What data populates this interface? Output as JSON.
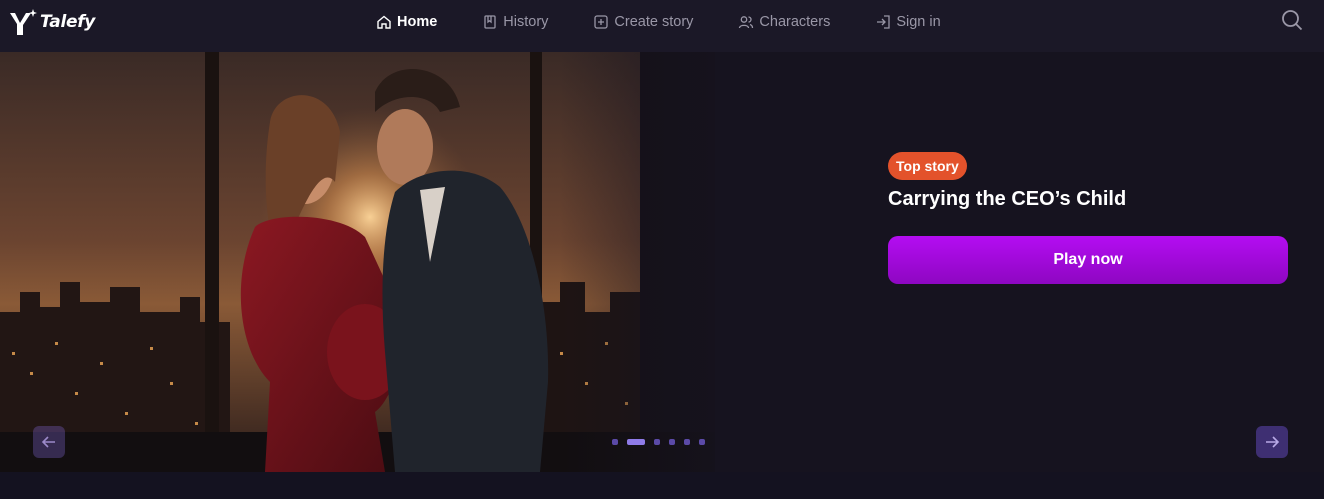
{
  "brand": {
    "name": "Talefy"
  },
  "nav": {
    "items": [
      {
        "label": "Home",
        "icon": "home-icon",
        "active": true
      },
      {
        "label": "History",
        "icon": "bookmark-icon",
        "active": false
      },
      {
        "label": "Create story",
        "icon": "plus-square-icon",
        "active": false
      },
      {
        "label": "Characters",
        "icon": "users-icon",
        "active": false
      },
      {
        "label": "Sign in",
        "icon": "sign-in-icon",
        "active": false
      }
    ]
  },
  "search": {
    "icon": "search-icon"
  },
  "hero": {
    "badge": "Top story",
    "title": "Carrying the CEO’s Child",
    "cta": "Play now",
    "slides": {
      "count": 6,
      "active_index": 1
    }
  },
  "colors": {
    "header_bg": "#1b1827",
    "page_bg": "#141220",
    "badge": "#e3522b",
    "cta": "#b40df2",
    "dot_active": "#8f7be8",
    "dot": "#5b4aa8"
  }
}
